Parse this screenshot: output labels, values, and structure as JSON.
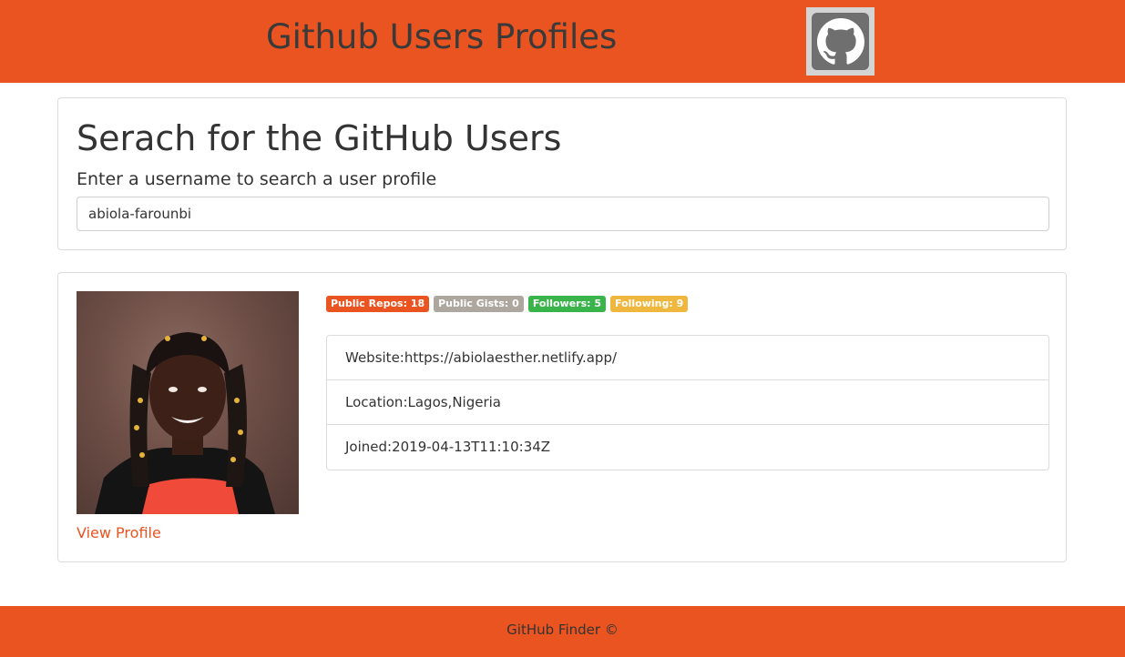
{
  "header": {
    "title": "Github Users Profiles",
    "logo_icon": "github-icon"
  },
  "search": {
    "heading": "Serach for the GitHub Users",
    "subheading": "Enter a username to search a user profile",
    "input_value": "abiola-farounbi"
  },
  "profile": {
    "avatar_alt": "user avatar",
    "view_profile_label": "View Profile",
    "badges": {
      "repos": "Public Repos: 18",
      "gists": "Public Gists: 0",
      "followers": "Followers: 5",
      "following": "Following: 9"
    },
    "badge_colors": {
      "repos": "#e95420",
      "gists": "#aea79f",
      "followers": "#38b44a",
      "following": "#efb73e"
    },
    "info": {
      "website": "Website:https://abiolaesther.netlify.app/",
      "location": "Location:Lagos,Nigeria",
      "joined": "Joined:2019-04-13T11:10:34Z"
    }
  },
  "footer": {
    "text": "GitHub Finder ©"
  },
  "colors": {
    "brand": "#e95420"
  }
}
